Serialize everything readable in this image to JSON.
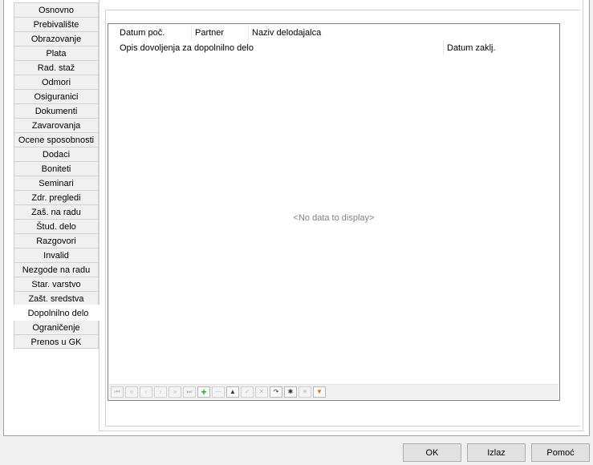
{
  "tabs": [
    {
      "label": "Osnovno"
    },
    {
      "label": "Prebivalište"
    },
    {
      "label": "Obrazovanje"
    },
    {
      "label": "Plata"
    },
    {
      "label": "Rad. staž"
    },
    {
      "label": "Odmori"
    },
    {
      "label": "Osiguranici"
    },
    {
      "label": "Dokumenti"
    },
    {
      "label": "Zavarovanja"
    },
    {
      "label": "Ocene sposobnosti"
    },
    {
      "label": "Dodaci"
    },
    {
      "label": "Boniteti"
    },
    {
      "label": "Seminari"
    },
    {
      "label": "Zdr. pregledi"
    },
    {
      "label": "Zaš. na radu"
    },
    {
      "label": "Štud. delo"
    },
    {
      "label": "Razgovori"
    },
    {
      "label": "Invalid"
    },
    {
      "label": "Nezgode na radu"
    },
    {
      "label": "Star. varstvo"
    },
    {
      "label": "Zašt. sredstva"
    },
    {
      "label": "Dopolnilno delo",
      "active": true
    },
    {
      "label": "Ograničenje"
    },
    {
      "label": "Prenos u GK"
    }
  ],
  "grid": {
    "columns_row1": [
      "Datum poč.",
      "Partner",
      "Naziv delodajalca"
    ],
    "columns_row2": [
      "Opis dovoljenja za dopolnilno delo",
      "Datum zaklj."
    ],
    "empty_text": "<No data to display>"
  },
  "navigator": {
    "icons": [
      "first-icon",
      "prev-page-icon",
      "prev-icon",
      "next-icon",
      "next-page-icon",
      "last-icon",
      "plus-icon",
      "minus-icon",
      "up-icon",
      "check-icon",
      "cross-icon",
      "refresh-icon",
      "asterisk-icon",
      "clear-icon",
      "filter-icon"
    ],
    "glyphs": [
      "⏮",
      "«",
      "‹",
      "›",
      "»",
      "⏭",
      "+",
      "—",
      "▲",
      "✓",
      "✕",
      "↷",
      "✱",
      "✳",
      "▼"
    ]
  },
  "buttons": {
    "ok": "OK",
    "izlaz": "Izlaz",
    "pomoc": "Pomoć"
  }
}
